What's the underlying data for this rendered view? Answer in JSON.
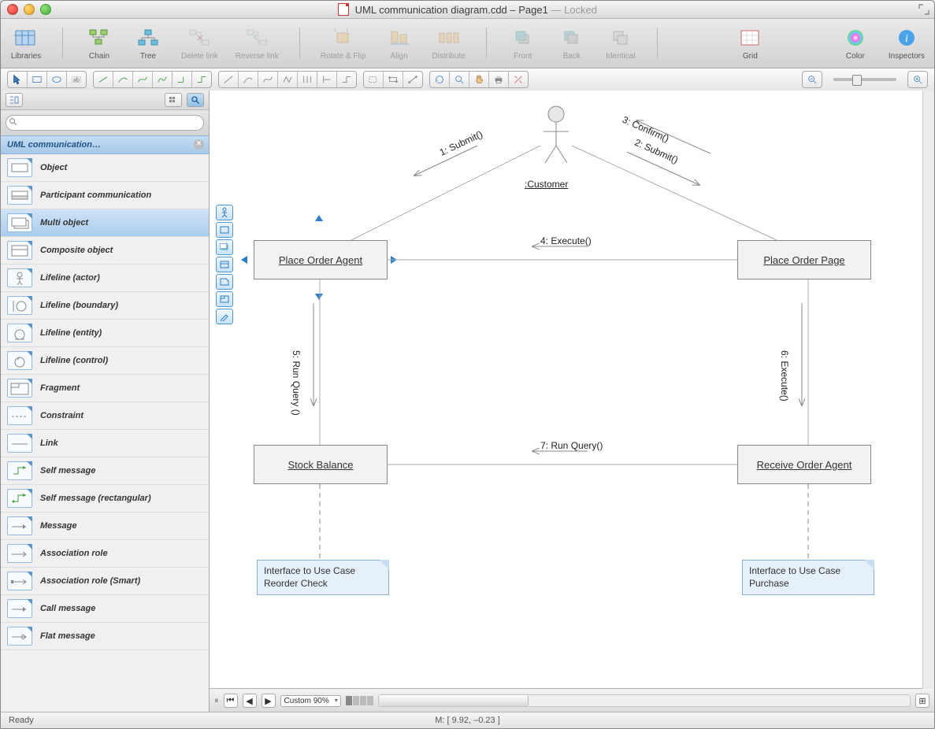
{
  "window": {
    "title_file": "UML communication diagram.cdd – Page1",
    "title_suffix": " — Locked"
  },
  "toolbar": {
    "items": [
      {
        "label": "Libraries",
        "name": "libraries-button",
        "dim": false
      },
      {
        "label": "Chain",
        "name": "chain-button",
        "dim": false,
        "sep_before": true
      },
      {
        "label": "Tree",
        "name": "tree-button",
        "dim": false
      },
      {
        "label": "Delete link",
        "name": "delete-link-button",
        "dim": true
      },
      {
        "label": "Reverse link",
        "name": "reverse-link-button",
        "dim": true
      },
      {
        "label": "Rotate & Flip",
        "name": "rotate-flip-button",
        "dim": true,
        "sep_before": true
      },
      {
        "label": "Align",
        "name": "align-button",
        "dim": true
      },
      {
        "label": "Distribute",
        "name": "distribute-button",
        "dim": true
      },
      {
        "label": "Front",
        "name": "front-button",
        "dim": true,
        "sep_before": true
      },
      {
        "label": "Back",
        "name": "back-button",
        "dim": true
      },
      {
        "label": "Identical",
        "name": "identical-button",
        "dim": true
      },
      {
        "label": "Grid",
        "name": "grid-button",
        "dim": false,
        "sep_before": true,
        "center": true
      },
      {
        "label": "Color",
        "name": "color-button",
        "dim": false
      },
      {
        "label": "Inspectors",
        "name": "inspectors-button",
        "dim": false
      }
    ]
  },
  "side": {
    "search_placeholder": "",
    "lib_header": "UML communication…",
    "items": [
      {
        "name": "Object"
      },
      {
        "name": "Participant communication"
      },
      {
        "name": "Multi object",
        "selected": true
      },
      {
        "name": "Composite object"
      },
      {
        "name": "Lifeline (actor)"
      },
      {
        "name": "Lifeline (boundary)"
      },
      {
        "name": "Lifeline (entity)"
      },
      {
        "name": "Lifeline (control)"
      },
      {
        "name": "Fragment"
      },
      {
        "name": "Constraint"
      },
      {
        "name": "Link"
      },
      {
        "name": "Self message"
      },
      {
        "name": "Self message (rectangular)"
      },
      {
        "name": "Message"
      },
      {
        "name": "Association role"
      },
      {
        "name": "Association role (Smart)"
      },
      {
        "name": "Call message"
      },
      {
        "name": "Flat message"
      }
    ]
  },
  "diagram": {
    "actor_label": ":Customer",
    "nodes": {
      "place_order_agent": "Place Order Agent",
      "place_order_page": "Place Order Page",
      "stock_balance": "Stock Balance",
      "receive_order_agent": "Receive Order Agent"
    },
    "notes": {
      "reorder": "Interface to Use Case\nReorder Check",
      "purchase": "Interface to Use Case\nPurchase"
    },
    "messages": {
      "m1": "1: Submit()",
      "m2": "2: Submit()",
      "m3": "3: Confirm()",
      "m4": "4: Execute()",
      "m5": "5: Run Query ()",
      "m6": "6: Execute()",
      "m7": "7: Run Query()"
    }
  },
  "footer": {
    "zoom": "Custom 90%",
    "status": "Ready",
    "coords": "M: [ 9.92, –0.23 ]"
  }
}
